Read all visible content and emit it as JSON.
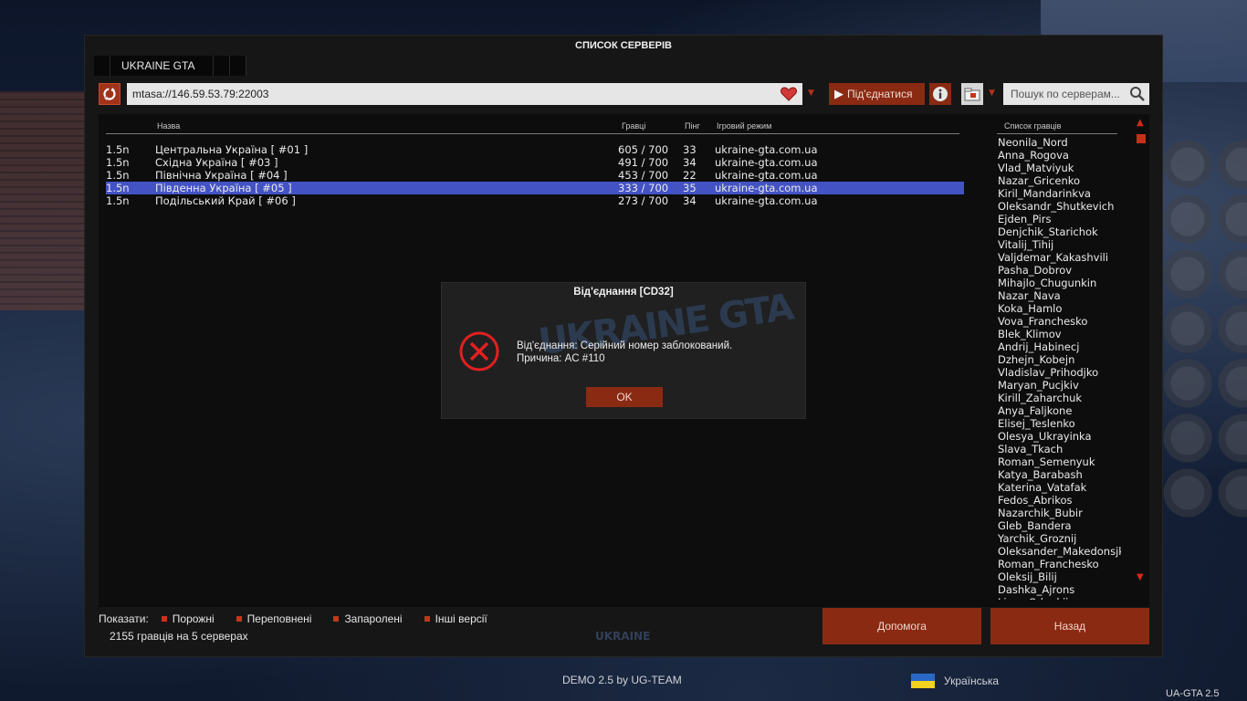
{
  "window": {
    "title": "СПИСОК СЕРВЕРІВ",
    "tab_label": "UKRAINE GTA"
  },
  "toolbar": {
    "address_value": "mtasa://146.59.53.79:22003",
    "connect_label": "Під'єднатися",
    "search_placeholder": "Пошук по серверам..."
  },
  "columns": {
    "name": "Назва",
    "players": "Гравці",
    "ping": "Пінг",
    "gamemode": "Ігровий режим"
  },
  "servers": [
    {
      "version": "1.5n",
      "name": "Центральна Україна [ #01 ]",
      "players": "605 / 700",
      "ping": "33",
      "gamemode": "ukraine-gta.com.ua",
      "selected": false
    },
    {
      "version": "1.5n",
      "name": "Східна Україна [ #03 ]",
      "players": "491 / 700",
      "ping": "34",
      "gamemode": "ukraine-gta.com.ua",
      "selected": false
    },
    {
      "version": "1.5n",
      "name": "Північна Україна [ #04 ]",
      "players": "453 / 700",
      "ping": "22",
      "gamemode": "ukraine-gta.com.ua",
      "selected": false
    },
    {
      "version": "1.5n",
      "name": "Південна Україна [ #05 ]",
      "players": "333 / 700",
      "ping": "35",
      "gamemode": "ukraine-gta.com.ua",
      "selected": true
    },
    {
      "version": "1.5n",
      "name": "Подільський Край [ #06 ]",
      "players": "273 / 700",
      "ping": "34",
      "gamemode": "ukraine-gta.com.ua",
      "selected": false
    }
  ],
  "players_panel": {
    "title": "Список гравців",
    "names": [
      "Neonila_Nord",
      "Anna_Rogova",
      "Vlad_Matviyuk",
      "Nazar_Gricenko",
      "Kiril_Mandarinkva",
      "Oleksandr_Shutkevich",
      "Ejden_Pirs",
      "Denjchik_Starichok",
      "Vitalij_Tihij",
      "Valjdemar_Kakashvili",
      "Pasha_Dobrov",
      "Mihajlo_Chugunkin",
      "Nazar_Nava",
      "Koka_Hamlo",
      "Vova_Franchesko",
      "Blek_Klimov",
      "Andrij_Habinecj",
      "Dzhejn_Kobejn",
      "Vladislav_Prihodjko",
      "Maryan_Pucjkiv",
      "Kirill_Zaharchuk",
      "Anya_Faljkone",
      "Elisej_Teslenko",
      "Olesya_Ukrayinka",
      "Slava_Tkach",
      "Roman_Semenyuk",
      "Katya_Barabash",
      "Katerina_Vatafak",
      "Fedos_Abrikos",
      "Nazarchik_Bubir",
      "Gleb_Bandera",
      "Yarchik_Groznij",
      "Oleksander_Makedonsjk",
      "Roman_Franchesko",
      "Oleksij_Bilij",
      "Dashka_Ajrons",
      "Liam_Odenkii"
    ]
  },
  "filters": {
    "label": "Показати:",
    "items": [
      "Порожні",
      "Переповнені",
      "Запаролені",
      "Інші версії"
    ]
  },
  "summary": "2155 гравців на 5 серверах",
  "buttons": {
    "help": "Допомога",
    "back": "Назад"
  },
  "dialog": {
    "title": "Від'єднання [CD32]",
    "line1": "Від'єднання: Серійний номер заблокований.",
    "line2": "Причина: AC #110",
    "ok": "OK",
    "watermark": "UKRAINE GTA"
  },
  "footer": {
    "demo": "DEMO 2.5 by UG-TEAM",
    "language": "Українська",
    "version": "UA-GTA 2.5"
  },
  "colors": {
    "accent": "#8a2a13",
    "selection": "#4453c4",
    "flag_blue": "#2a68c8",
    "flag_yellow": "#f4d21d"
  }
}
